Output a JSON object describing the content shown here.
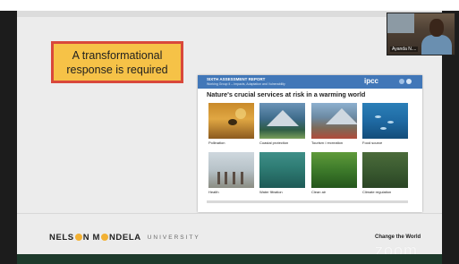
{
  "slide": {
    "headline_line1": "A transformational",
    "headline_line2": "response is required"
  },
  "report": {
    "header_title": "SIXTH ASSESSMENT REPORT",
    "header_subtitle": "Working Group II – Impacts, Adaptation and Vulnerability",
    "logo": "ipcc",
    "title": "Nature's crucial services at risk in a warming world",
    "tiles": [
      {
        "label": "Pollination"
      },
      {
        "label": "Coastal protection"
      },
      {
        "label": "Tourism  / recreation"
      },
      {
        "label": "Food source"
      },
      {
        "label": "Health"
      },
      {
        "label": "Water filtration"
      },
      {
        "label": "Clean air"
      },
      {
        "label": "Climate regulation"
      }
    ]
  },
  "footer": {
    "university_part1": "NELS",
    "university_part2": "N M",
    "university_part3": "NDELA",
    "university_part4": "UNIVERSITY",
    "tagline": "Change the World"
  },
  "zoom_watermark": "zoom",
  "participant": {
    "name": "Ayanda N...."
  },
  "colors": {
    "headline_fill": "#f6c247",
    "headline_border": "#d9483b",
    "report_header": "#4177b8",
    "logo_accent": "#f2b134"
  }
}
